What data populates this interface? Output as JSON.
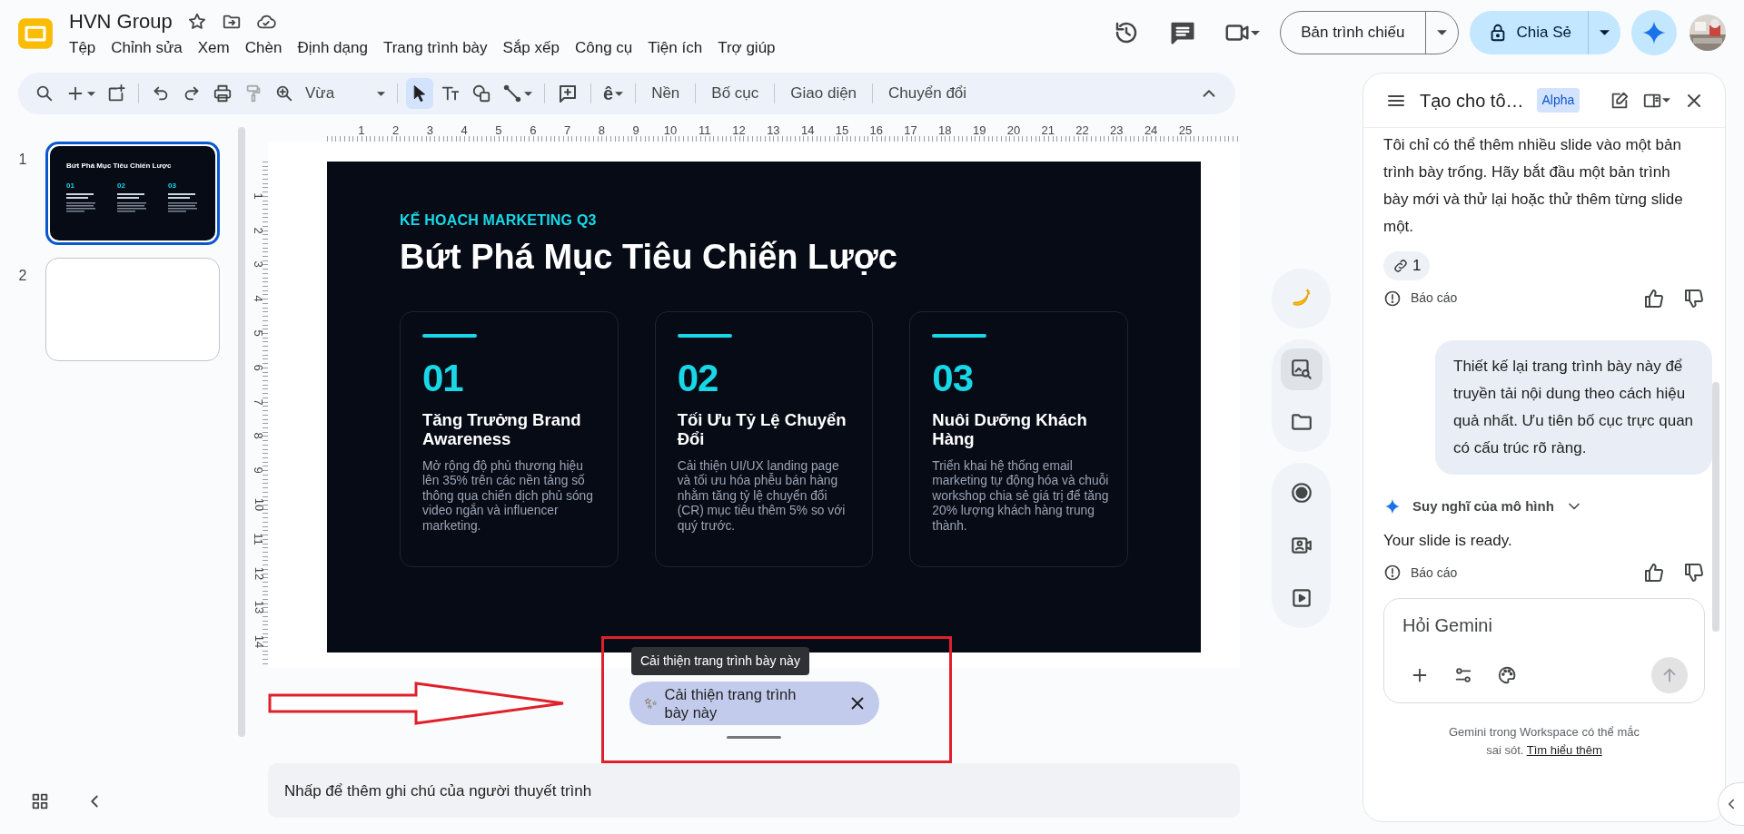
{
  "document": {
    "title": "HVN Group"
  },
  "menu": [
    "Tệp",
    "Chỉnh sửa",
    "Xem",
    "Chèn",
    "Định dạng",
    "Trang trình bày",
    "Sắp xếp",
    "Công cụ",
    "Tiện ích",
    "Trợ giúp"
  ],
  "header_actions": {
    "slideshow": "Bản trình chiếu",
    "share": "Chia Sẻ"
  },
  "toolbar": {
    "zoom": "Vừa",
    "select_active": true,
    "input_tool": "ê",
    "buttons": [
      "Nền",
      "Bố cục",
      "Giao diện",
      "Chuyển đổi"
    ]
  },
  "thumbnails": [
    {
      "number": "1",
      "selected": true,
      "title": "Bứt Phá Mục Tiêu Chiến Lược",
      "items": [
        "01",
        "02",
        "03"
      ]
    },
    {
      "number": "2",
      "selected": false
    }
  ],
  "rulers": {
    "horizontal": [
      "1",
      "2",
      "3",
      "4",
      "5",
      "6",
      "7",
      "8",
      "9",
      "10",
      "11",
      "12",
      "13",
      "14",
      "15",
      "16",
      "17",
      "18",
      "19",
      "20",
      "21",
      "22",
      "23",
      "24",
      "25"
    ],
    "vertical": [
      "1",
      "2",
      "3",
      "4",
      "5",
      "6",
      "7",
      "8",
      "9",
      "10",
      "11",
      "12",
      "13",
      "14"
    ]
  },
  "slide": {
    "eyebrow": "KẾ HOẠCH MARKETING Q3",
    "title": "Bứt Phá Mục Tiêu Chiến Lược",
    "cards": [
      {
        "number": "01",
        "heading": "Tăng Trưởng Brand Awareness",
        "body": "Mở rộng độ phủ thương hiệu lên 35% trên các nền tảng số thông qua chiến dịch phủ sóng video ngắn và influencer marketing."
      },
      {
        "number": "02",
        "heading": "Tối Ưu Tỷ Lệ Chuyển Đổi",
        "body": "Cải thiện UI/UX landing page và tối ưu hóa phễu bán hàng nhằm tăng tỷ lệ chuyển đổi (CR) mục tiêu thêm 5% so với quý trước."
      },
      {
        "number": "03",
        "heading": "Nuôi Dưỡng Khách Hàng",
        "body": "Triển khai hệ thống email marketing tự động hóa và chuỗi workshop chia sẻ giá trị để tăng 20% lượng khách hàng trung thành."
      }
    ]
  },
  "tooltip": "Cải thiện trang trình bày này",
  "suggestion_chip": {
    "icon": "✨",
    "label": "Cải thiện trang trình bày này"
  },
  "speaker_notes": {
    "placeholder": "Nhấp để thêm ghi chú của người thuyết trình"
  },
  "side_rail": [
    {
      "items": [
        {
          "kind": "banana",
          "selected": false
        }
      ]
    },
    {
      "items": [
        {
          "kind": "image-search",
          "selected": true
        },
        {
          "kind": "folder",
          "selected": false
        }
      ]
    },
    {
      "items": [
        {
          "kind": "record",
          "selected": false
        },
        {
          "kind": "camera",
          "selected": false
        },
        {
          "kind": "present",
          "selected": false
        }
      ]
    }
  ],
  "gemini": {
    "title": "Tạo cho tô…",
    "badge": "Alpha",
    "messages": [
      {
        "kind": "model",
        "text": "Tôi chỉ có thể thêm nhiều slide vào một bản trình bày trống. Hãy bắt đầu một bản trình bày mới và thử lại hoặc thử thêm từng slide một.",
        "sources": "1",
        "report": "Báo cáo"
      },
      {
        "kind": "user",
        "text": "Thiết kế lại trang trình bày này để truyền tải nội dung theo cách hiệu quả nhất. Ưu tiên bố cục trực quan có cấu trúc rõ ràng."
      },
      {
        "kind": "model",
        "thinking": "Suy nghĩ của mô hình",
        "text": "Your slide is ready.",
        "report": "Báo cáo"
      }
    ],
    "input": {
      "placeholder": "Hỏi Gemini"
    },
    "disclaimer": "Gemini trong Workspace có thể mắc sai sót.",
    "link": "Tìm hiểu thêm"
  }
}
